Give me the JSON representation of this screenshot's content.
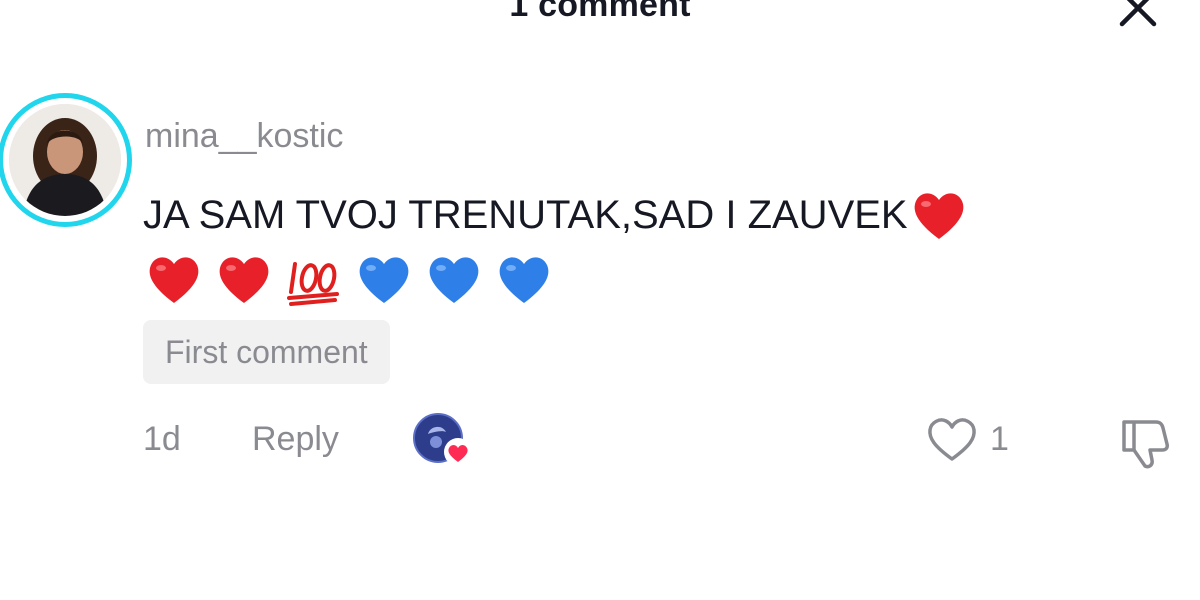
{
  "header": {
    "title": "1 comment"
  },
  "comment": {
    "username": "mina__kostic",
    "text_line1": "JA SAM TVOJ TRENUTAK,SAD I ZAUVEK",
    "badge": "First comment",
    "time": "1d",
    "reply_label": "Reply",
    "like_count": "1"
  },
  "icons": {
    "close": "close-icon",
    "heart_red": "red-heart-emoji",
    "hundred": "hundred-points-emoji",
    "heart_blue": "blue-heart-emoji",
    "like": "heart-outline-icon",
    "dislike": "thumbs-down-icon",
    "creator_like": "liked-by-creator-avatar"
  },
  "colors": {
    "avatar_ring": "#20d5ec",
    "muted_text": "#8a8b91",
    "heart_red": "#e8202a",
    "heart_blue": "#2f7fe8"
  }
}
